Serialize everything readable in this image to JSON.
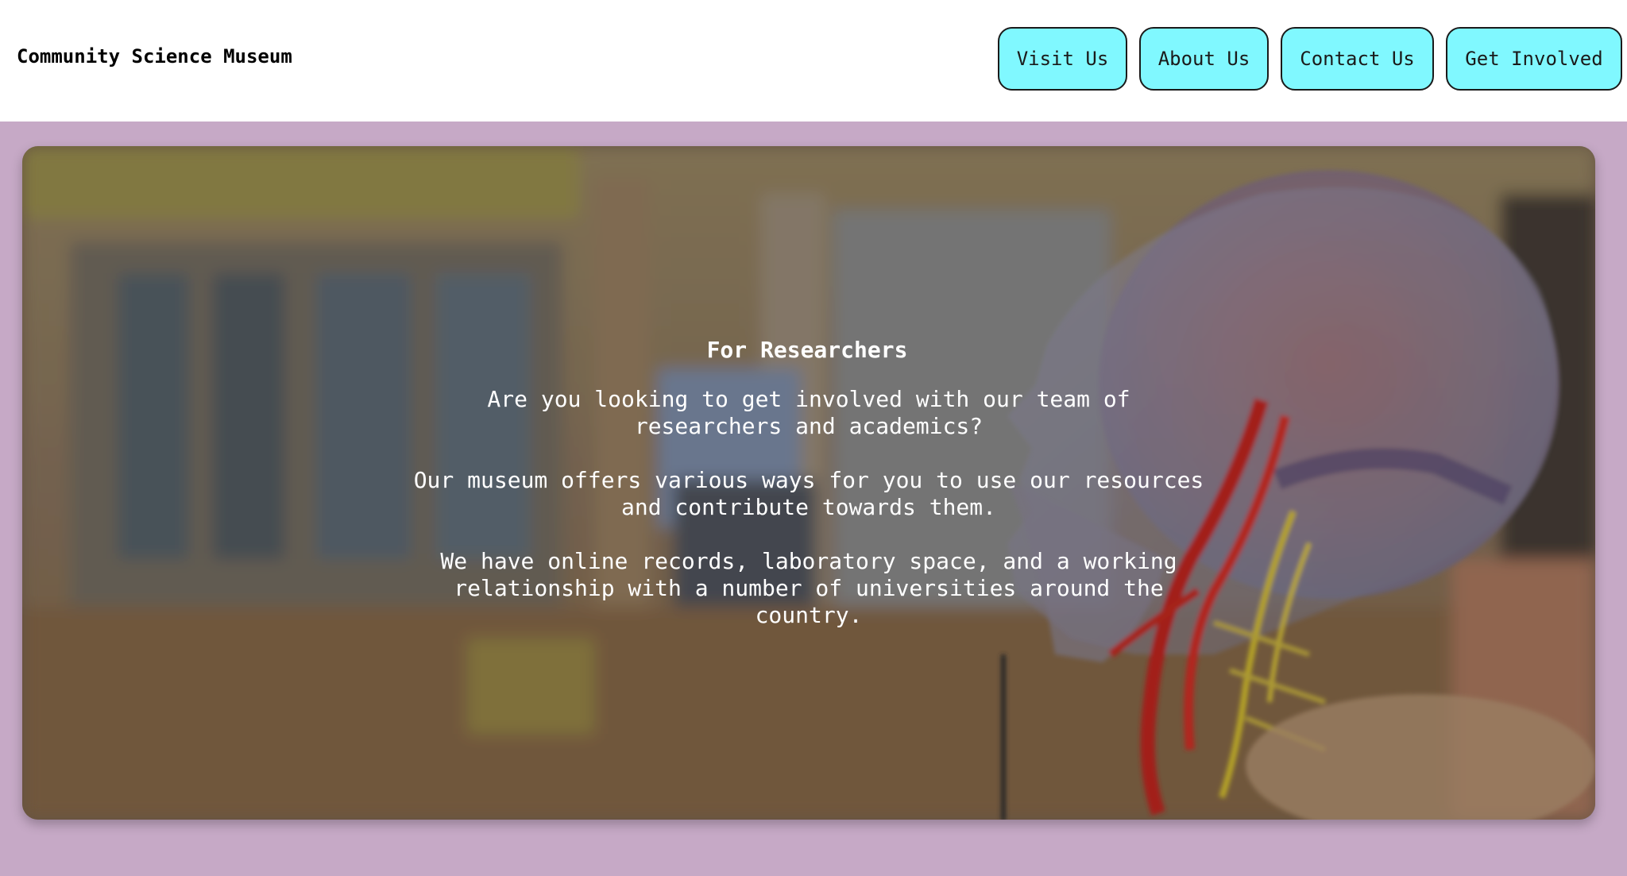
{
  "header": {
    "site_title": "Community Science Museum",
    "nav": [
      {
        "label": "Visit Us"
      },
      {
        "label": "About Us"
      },
      {
        "label": "Contact Us"
      },
      {
        "label": "Get Involved"
      }
    ]
  },
  "hero": {
    "title": "For Researchers",
    "paragraphs": [
      "Are you looking to get involved with our team of researchers and academics?",
      "Our museum offers various ways for you to use our resources and contribute towards them.",
      "We have online records, laboratory space, and a working relationship with a number of universities around the country."
    ]
  },
  "colors": {
    "nav_button_bg": "#80f8ff",
    "main_background": "#c6a9c6",
    "text_on_image": "#ffffff"
  }
}
